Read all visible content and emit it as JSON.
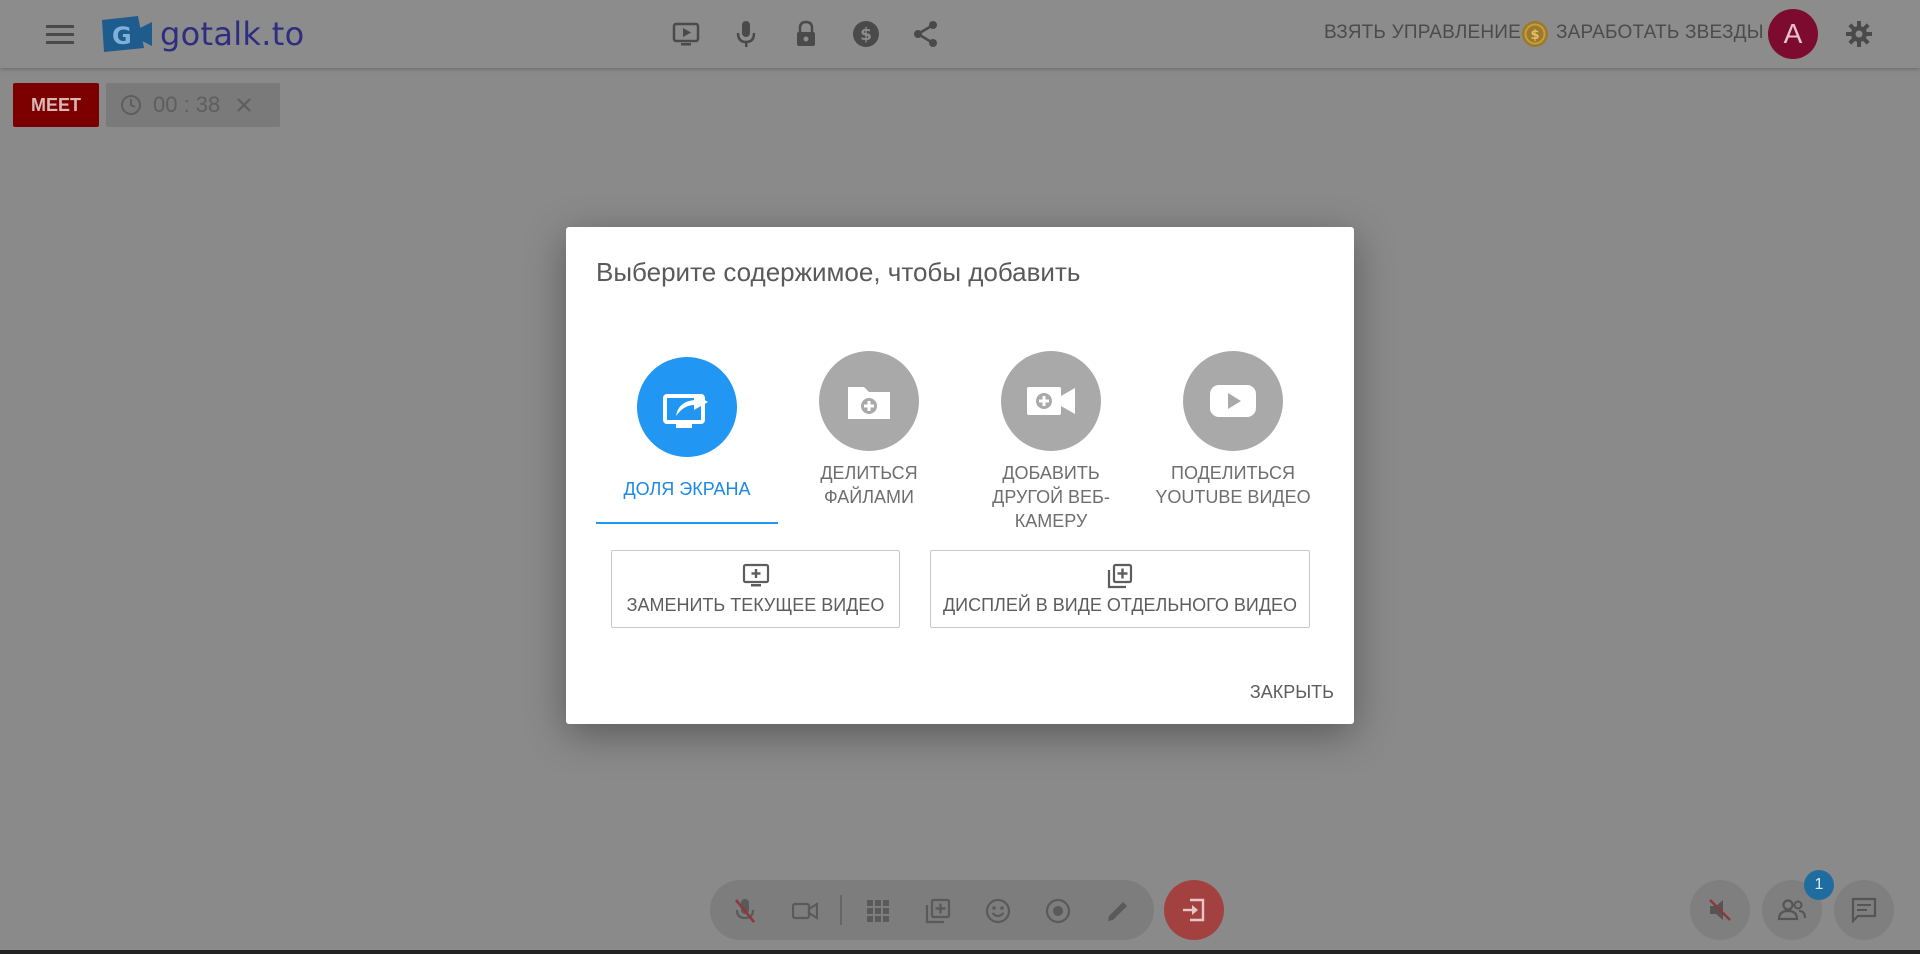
{
  "app": {
    "logo_text": "gotalk.to",
    "logo_letter": "G"
  },
  "topbar": {
    "icons": [
      "menu-icon",
      "present-icon",
      "microphone-icon",
      "lock-icon",
      "dollar-icon",
      "share-icon"
    ],
    "take_control_label": "ВЗЯТЬ УПРАВЛЕНИЕ",
    "earn_stars_label": "ЗАРАБОТАТЬ ЗВЕЗДЫ",
    "avatar_letter": "A"
  },
  "meeting": {
    "meet_label": "MEET",
    "timer": "00 : 38"
  },
  "dialog": {
    "title": "Выберите содержимое, чтобы добавить",
    "tabs": [
      {
        "label": "Доля экрана",
        "icon": "screen-share-icon",
        "active": true
      },
      {
        "label": "Делиться файлами",
        "icon": "folder-add-icon",
        "active": false
      },
      {
        "label": "Добавить другой веб-камеру",
        "icon": "camera-add-icon",
        "active": false
      },
      {
        "label": "Поделиться YouTube видео",
        "icon": "youtube-icon",
        "active": false
      }
    ],
    "options": [
      {
        "label": "ЗАМЕНИТЬ ТЕКУЩЕЕ ВИДЕО",
        "icon": "replace-video-icon"
      },
      {
        "label": "ДИСПЛЕЙ В ВИДЕ ОТДЕЛЬНОГО ВИДЕО",
        "icon": "add-layer-icon"
      }
    ],
    "close_label": "ЗАКРЫТЬ"
  },
  "bottom_bar": {
    "participants_count": "1"
  },
  "colors": {
    "accent": "#2196f3",
    "meet_badge": "#7d0000",
    "avatar": "#7c0b2f",
    "leave": "#a34141"
  }
}
